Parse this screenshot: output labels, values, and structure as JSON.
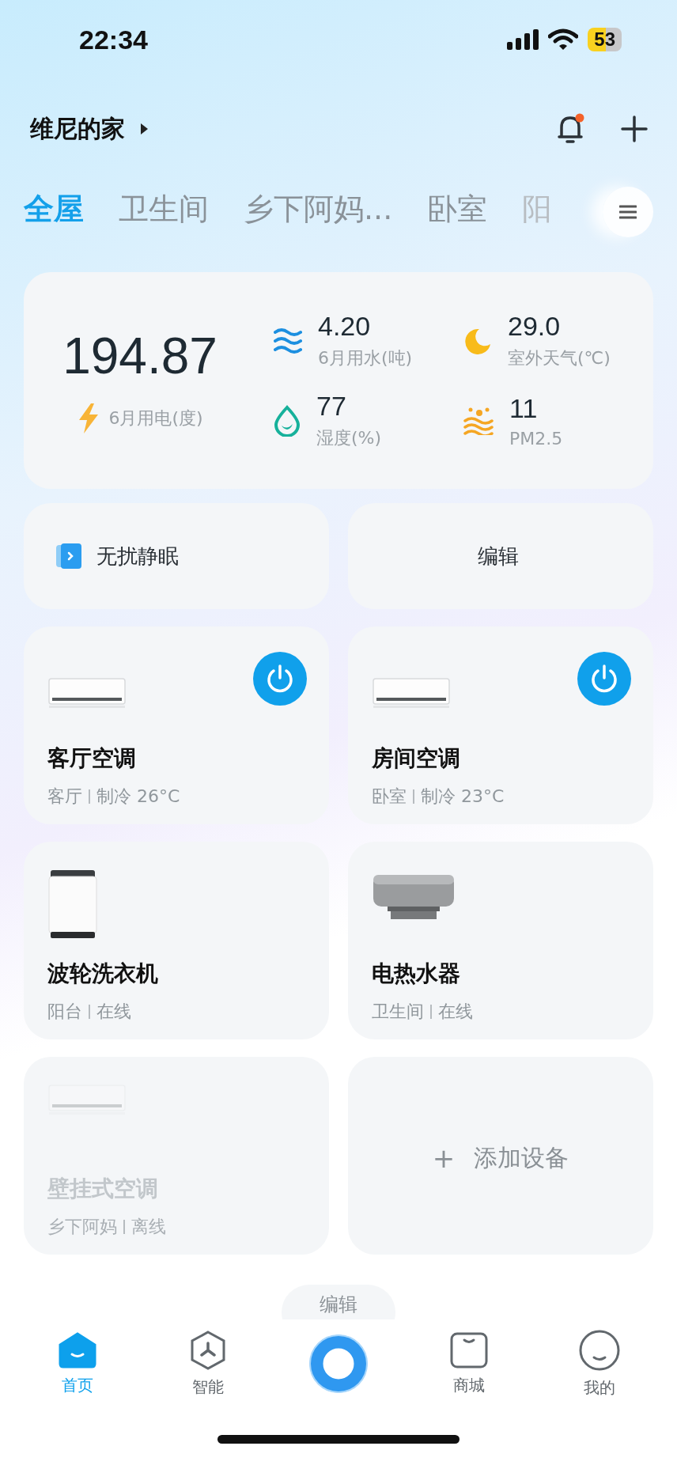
{
  "status_bar": {
    "time": "22:34",
    "battery": "53"
  },
  "header": {
    "home_name": "维尼的家",
    "notification_unread": true
  },
  "tabs": [
    {
      "label": "全屋",
      "selected": true
    },
    {
      "label": "卫生间",
      "selected": false
    },
    {
      "label": "乡下阿妈...",
      "selected": false
    },
    {
      "label": "卧室",
      "selected": false
    },
    {
      "label": "阳",
      "selected": false
    }
  ],
  "energy": {
    "value": "194.87",
    "label": "6月用电(度)"
  },
  "stats": [
    {
      "kind": "water",
      "value": "4.20",
      "label": "6月用水(吨)"
    },
    {
      "kind": "weather",
      "value": "29.0",
      "label": "室外天气(℃)"
    },
    {
      "kind": "humidity",
      "value": "77",
      "label": "湿度(%)"
    },
    {
      "kind": "pm",
      "value": "11",
      "label": "PM2.5"
    }
  ],
  "scenes": [
    {
      "kind": "scene",
      "label": "无扰静眠"
    },
    {
      "kind": "edit",
      "label": "编辑"
    }
  ],
  "devices": [
    {
      "kind": "ac",
      "name": "客厅空调",
      "room": "客厅",
      "status": "制冷 26°C",
      "online": true,
      "on": true
    },
    {
      "kind": "ac",
      "name": "房间空调",
      "room": "卧室",
      "status": "制冷 23°C",
      "online": true,
      "on": true
    },
    {
      "kind": "washer",
      "name": "波轮洗衣机",
      "room": "阳台",
      "status": "在线",
      "online": true
    },
    {
      "kind": "heater",
      "name": "电热水器",
      "room": "卫生间",
      "status": "在线",
      "online": true
    },
    {
      "kind": "ac",
      "name": "壁挂式空调",
      "room": "乡下阿妈",
      "status": "离线",
      "online": false
    },
    {
      "kind": "add",
      "name": "添加设备",
      "plus": "+"
    }
  ],
  "edit_button": "编辑",
  "nav": [
    {
      "kind": "home",
      "label": "首页",
      "selected": true
    },
    {
      "kind": "smart",
      "label": "智能",
      "selected": false
    },
    {
      "kind": "assistant",
      "selected": false
    },
    {
      "kind": "mall",
      "label": "商城",
      "selected": false
    },
    {
      "kind": "me",
      "label": "我的",
      "selected": false
    }
  ]
}
